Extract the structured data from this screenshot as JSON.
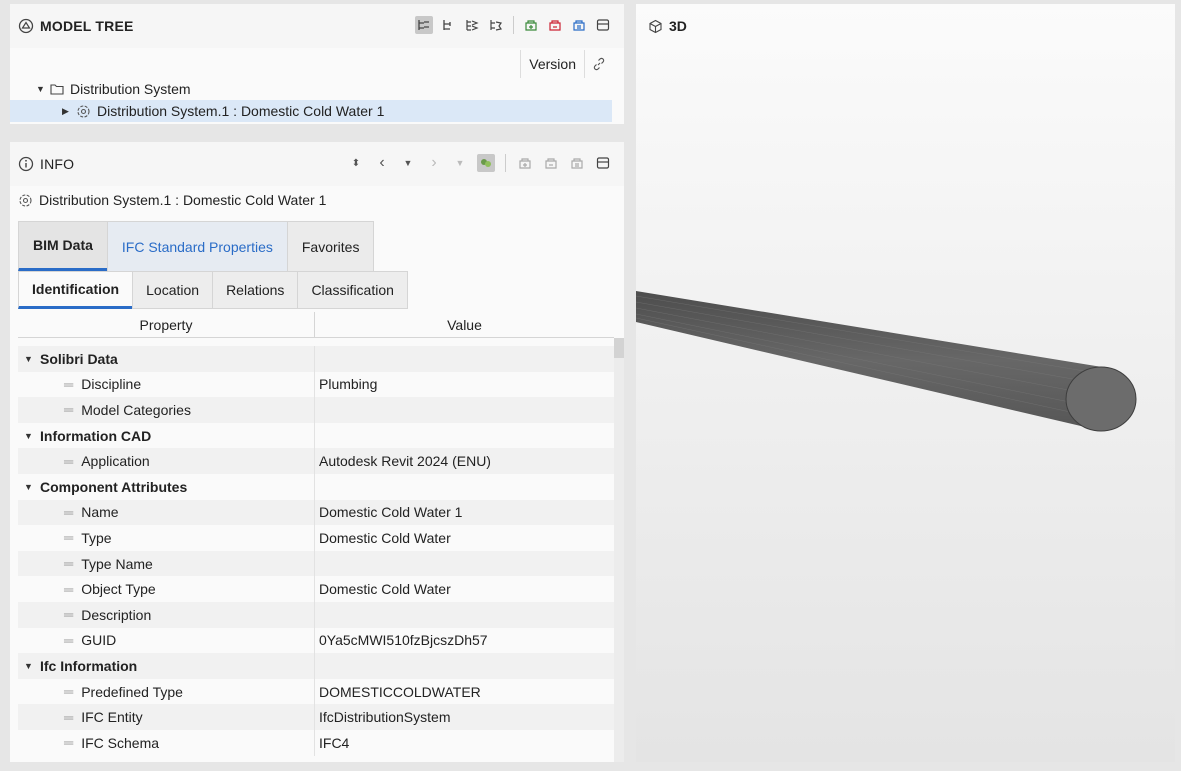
{
  "model_tree": {
    "title": "MODEL TREE",
    "column_version": "Version",
    "rows": [
      {
        "label": "Distribution System"
      },
      {
        "label": "Distribution System.1 : Domestic Cold Water 1"
      }
    ]
  },
  "info": {
    "title": "INFO",
    "object_name": "Distribution System.1 : Domestic Cold Water 1",
    "tabs": [
      "BIM Data",
      "IFC Standard Properties",
      "Favorites"
    ],
    "subtabs": [
      "Identification",
      "Location",
      "Relations",
      "Classification"
    ],
    "columns": {
      "property": "Property",
      "value": "Value"
    },
    "rows": [
      {
        "type": "group",
        "property": "Solibri Data",
        "value": ""
      },
      {
        "type": "item",
        "property": "Discipline",
        "value": "Plumbing"
      },
      {
        "type": "item",
        "property": "Model Categories",
        "value": ""
      },
      {
        "type": "group",
        "property": "Information CAD",
        "value": ""
      },
      {
        "type": "item",
        "property": "Application",
        "value": "Autodesk Revit 2024 (ENU)"
      },
      {
        "type": "group",
        "property": "Component Attributes",
        "value": ""
      },
      {
        "type": "item",
        "property": "Name",
        "value": "Domestic Cold Water 1"
      },
      {
        "type": "item",
        "property": "Type",
        "value": "Domestic Cold Water"
      },
      {
        "type": "item",
        "property": "Type Name",
        "value": ""
      },
      {
        "type": "item",
        "property": "Object Type",
        "value": "Domestic Cold Water"
      },
      {
        "type": "item",
        "property": "Description",
        "value": ""
      },
      {
        "type": "item",
        "property": "GUID",
        "value": "0Ya5cMWI510fzBjcszDh57"
      },
      {
        "type": "group",
        "property": "Ifc Information",
        "value": ""
      },
      {
        "type": "item",
        "property": "Predefined Type",
        "value": "DOMESTICCOLDWATER"
      },
      {
        "type": "item",
        "property": "IFC Entity",
        "value": "IfcDistributionSystem"
      },
      {
        "type": "item",
        "property": "IFC Schema",
        "value": "IFC4"
      }
    ]
  },
  "viewport": {
    "title": "3D"
  },
  "colors": {
    "accent": "#2a6cc7",
    "selection": "#dbe8f7",
    "pipe": "#5b5b5b"
  }
}
